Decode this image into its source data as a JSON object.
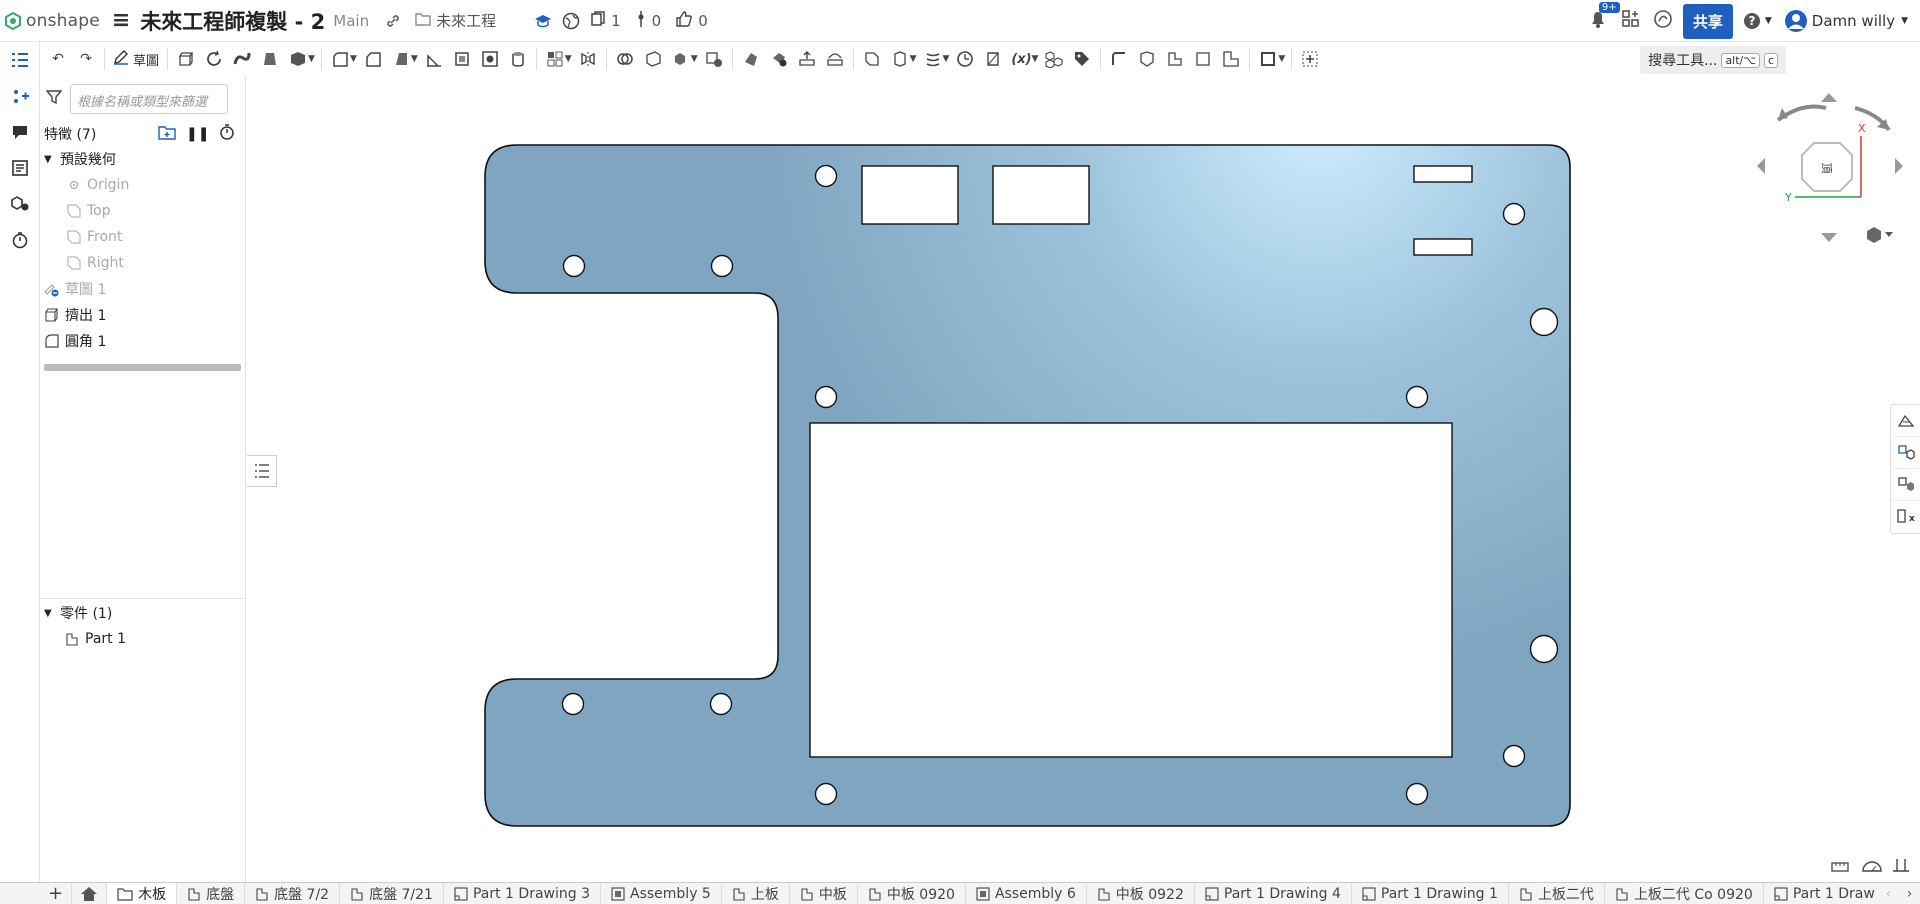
{
  "app": {
    "name": "onshape"
  },
  "document": {
    "title": "未來工程師複製 - 2",
    "branch": "Main",
    "folder": "未來工程",
    "versions": "1",
    "branches": "0",
    "likes": "0"
  },
  "topright": {
    "notif_badge": "9+",
    "share_label": "共享",
    "user_name": "Damn willy"
  },
  "toolbar": {
    "sketch_label": "草圖",
    "search_label": "搜尋工具...",
    "search_kbd1": "alt/⌥",
    "search_kbd2": "c"
  },
  "panel": {
    "filter_placeholder": "根據名稱或類型來篩選",
    "features_header": "特徵 (7)",
    "default_geometry": "預設幾何",
    "origin": "Origin",
    "planes": [
      "Top",
      "Front",
      "Right"
    ],
    "features": [
      "草圖 1",
      "擠出 1",
      "圓角 1"
    ],
    "parts_header": "零件 (1)",
    "parts": [
      "Part 1"
    ]
  },
  "viewcube": {
    "face_label": "頂",
    "axis_x": "X",
    "axis_y": "Y"
  },
  "tabs": [
    "木板",
    "底盤",
    "底盤 7/2",
    "底盤 7/21",
    "Part 1 Drawing 3",
    "Assembly 5",
    "上板",
    "中板",
    "中板 0920",
    "Assembly 6",
    "中板 0922",
    "Part 1 Drawing 4",
    "Part 1 Drawing 1",
    "上板二代",
    "上板二代 Co 0920",
    "Part 1 Draw"
  ],
  "colors": {
    "part_fill": "#7fa5c0",
    "part_highlight": "#cdeeff",
    "brand_blue": "#1f5fbf"
  }
}
